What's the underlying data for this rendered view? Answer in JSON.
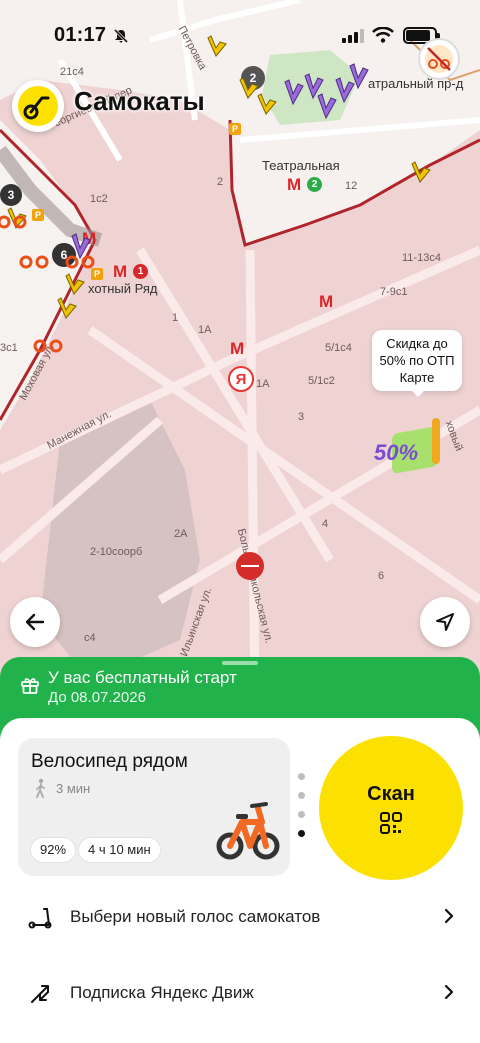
{
  "status_bar": {
    "time": "01:17"
  },
  "header": {
    "title": "Самокаты"
  },
  "map": {
    "labels": {
      "teatralnaya": "Театральная",
      "okhotny_ryad": "хотный Ряд",
      "teatralny_pr": "атральный пр-д",
      "petrovka": "Петровка",
      "georgievsky": "Георгиевский пер",
      "mokhovaya": "Моховая ул.",
      "manezhnaya": "Манежная ул.",
      "nikolskaya": "Больш. Никольская ул.",
      "ilyinka": "Ильинская ул.",
      "sobornaya": "2-10соорб",
      "rybny": "ховый",
      "b1": "1",
      "b2": "2",
      "b3": "3",
      "b4": "4",
      "b1a": "1А",
      "b1a2": "1А",
      "b2a": "2А",
      "b5_1c4": "5/1с4",
      "b5_1c2": "5/1с2",
      "b7_9c1": "7-9с1",
      "b11_13c4": "11-13с4",
      "b3c1": "3с1",
      "b1c2": "1с2",
      "b21c4": "21с4",
      "bc4": "с4",
      "b6": "6",
      "b12": "12"
    },
    "metro_lines": {
      "okhotny": "1",
      "teatralnaya": "2"
    },
    "clusters": {
      "c2": "2",
      "c3": "3",
      "c6": "6"
    },
    "parking": "P"
  },
  "promo": {
    "text": "Скидка до 50% по ОТП Карте",
    "badge": "50%"
  },
  "free_start": {
    "title": "У вас бесплатный старт",
    "date": "До 08.07.2026"
  },
  "bike_card": {
    "title": "Велосипед рядом",
    "walk_time": "3 мин",
    "battery": "92%",
    "range": "4 ч 10 мин"
  },
  "scan": {
    "label": "Скан"
  },
  "menu": [
    {
      "label": "Выбери новый голос самокатов",
      "icon": "scooter-icon"
    },
    {
      "label": "Подписка Яндекс Движ",
      "icon": "subscription-arrows-icon"
    }
  ],
  "colors": {
    "brand_yellow": "#fce000",
    "green": "#22b24b",
    "metro_red": "#d9262a",
    "map_pink": "#efd3d3"
  }
}
